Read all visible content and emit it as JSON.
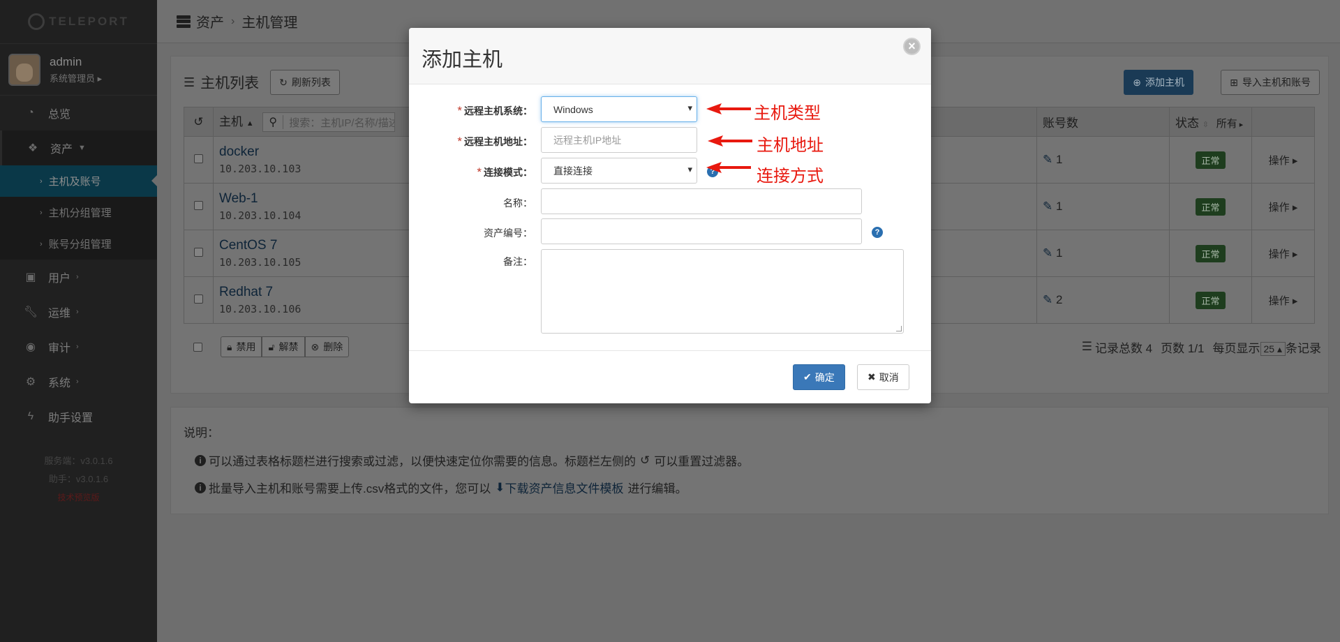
{
  "sidebar": {
    "logo": "TELEPORT",
    "user_name": "admin",
    "user_role": "系统管理员",
    "nav": {
      "dashboard": "总览",
      "assets": "资产",
      "sub_hosts_accounts": "主机及账号",
      "sub_host_groups": "主机分组管理",
      "sub_account_groups": "账号分组管理",
      "users": "用户",
      "ops": "运维",
      "audit": "审计",
      "system": "系统",
      "assistant": "助手设置"
    },
    "server_version": "服务端：v3.0.1.6",
    "assist_version": "助手：v3.0.1.6",
    "preview": "技术预览版"
  },
  "breadcrumb": {
    "root": "资产",
    "current": "主机管理"
  },
  "list": {
    "title": "主机列表",
    "refresh": "刷新列表",
    "add_host": "添加主机",
    "import": "导入主机和账号",
    "col_host": "主机",
    "search_placeholder": "搜索：主机IP/名称/描述",
    "col_accounts": "账号数",
    "col_status": "状态",
    "status_filter": "所有",
    "rows": [
      {
        "name": "docker",
        "ip": "10.203.10.103",
        "accounts": "1",
        "status": "正常",
        "op": "操作"
      },
      {
        "name": "Web-1",
        "ip": "10.203.10.104",
        "accounts": "1",
        "status": "正常",
        "op": "操作"
      },
      {
        "name": "CentOS 7",
        "ip": "10.203.10.105",
        "accounts": "1",
        "status": "正常",
        "op": "操作"
      },
      {
        "name": "Redhat 7",
        "ip": "10.203.10.106",
        "accounts": "2",
        "status": "正常",
        "op": "操作"
      }
    ],
    "btn_disable": "禁用",
    "btn_unlock": "解禁",
    "btn_delete": "删除",
    "total": "记录总数 4",
    "pages": "页数 1/1",
    "per_page_label": "每页显示",
    "per_page": "25",
    "per_page_suffix": "条记录"
  },
  "help": {
    "title": "说明：",
    "line1_a": "可以通过表格标题栏进行搜索或过滤，以便快速定位你需要的信息。标题栏左侧的",
    "line1_b": "可以重置过滤器。",
    "line2_a": "批量导入主机和账号需要上传.csv格式的文件，您可以",
    "line2_link": "下载资产信息文件模板",
    "line2_b": "进行编辑。"
  },
  "modal": {
    "title": "添加主机",
    "os_label": "远程主机系统：",
    "os_value": "Windows",
    "addr_label": "远程主机地址：",
    "addr_placeholder": "远程主机IP地址",
    "mode_label": "连接模式：",
    "mode_value": "直接连接",
    "name_label": "名称：",
    "asset_no_label": "资产编号：",
    "remark_label": "备注：",
    "ok": "确定",
    "cancel": "取消"
  },
  "annotations": {
    "a1": "主机类型",
    "a2": "主机地址",
    "a3": "连接方式"
  },
  "colors": {
    "annotation": "#e8190f",
    "primary": "#3a78b8",
    "sidebar_active": "#0a3848"
  }
}
